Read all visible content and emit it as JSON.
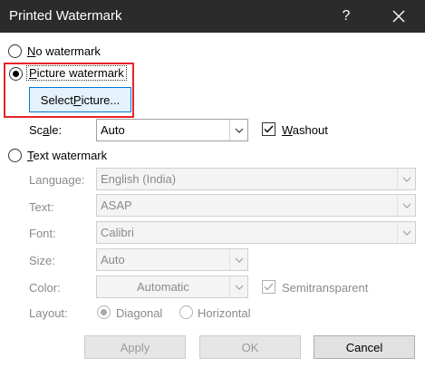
{
  "window": {
    "title": "Printed Watermark",
    "help_glyph": "?"
  },
  "options": {
    "no_watermark": "No watermark",
    "picture_watermark": "Picture watermark",
    "text_watermark": "Text watermark",
    "selected": "picture_watermark"
  },
  "picture": {
    "select_button": "Select Picture...",
    "scale_label": "Scale:",
    "scale_value": "Auto",
    "washout_label": "Washout",
    "washout_checked": true
  },
  "text": {
    "language_label": "Language:",
    "language_value": "English (India)",
    "text_label": "Text:",
    "text_value": "ASAP",
    "font_label": "Font:",
    "font_value": "Calibri",
    "size_label": "Size:",
    "size_value": "Auto",
    "color_label": "Color:",
    "color_value": "Automatic",
    "semitransparent_label": "Semitransparent",
    "semitransparent_checked": true,
    "layout_label": "Layout:",
    "layout_diagonal": "Diagonal",
    "layout_horizontal": "Horizontal",
    "layout_selected": "diagonal"
  },
  "buttons": {
    "apply": "Apply",
    "ok": "OK",
    "cancel": "Cancel"
  },
  "colors": {
    "titlebar": "#2b2b2b",
    "highlight": "#e5242b",
    "focus": "#0078d7"
  }
}
